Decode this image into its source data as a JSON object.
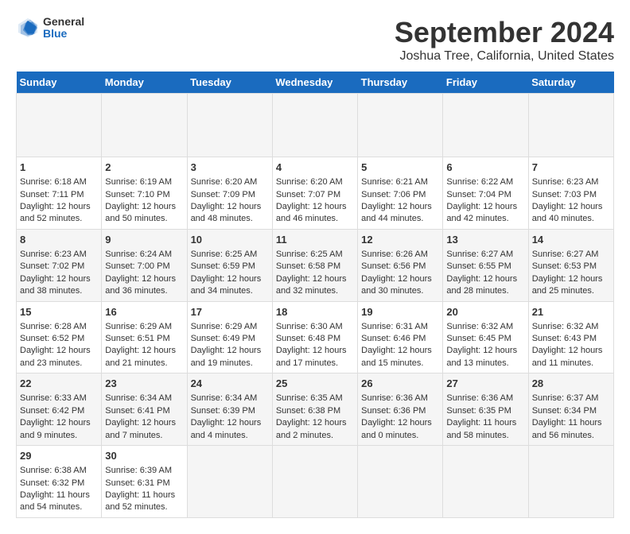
{
  "header": {
    "logo_general": "General",
    "logo_blue": "Blue",
    "title": "September 2024",
    "subtitle": "Joshua Tree, California, United States"
  },
  "calendar": {
    "days_of_week": [
      "Sunday",
      "Monday",
      "Tuesday",
      "Wednesday",
      "Thursday",
      "Friday",
      "Saturday"
    ],
    "weeks": [
      [
        {
          "day": "",
          "empty": true
        },
        {
          "day": "",
          "empty": true
        },
        {
          "day": "",
          "empty": true
        },
        {
          "day": "",
          "empty": true
        },
        {
          "day": "",
          "empty": true
        },
        {
          "day": "",
          "empty": true
        },
        {
          "day": "",
          "empty": true
        }
      ],
      [
        {
          "day": "1",
          "sunrise": "6:18 AM",
          "sunset": "7:11 PM",
          "daylight": "12 hours and 52 minutes."
        },
        {
          "day": "2",
          "sunrise": "6:19 AM",
          "sunset": "7:10 PM",
          "daylight": "12 hours and 50 minutes."
        },
        {
          "day": "3",
          "sunrise": "6:20 AM",
          "sunset": "7:09 PM",
          "daylight": "12 hours and 48 minutes."
        },
        {
          "day": "4",
          "sunrise": "6:20 AM",
          "sunset": "7:07 PM",
          "daylight": "12 hours and 46 minutes."
        },
        {
          "day": "5",
          "sunrise": "6:21 AM",
          "sunset": "7:06 PM",
          "daylight": "12 hours and 44 minutes."
        },
        {
          "day": "6",
          "sunrise": "6:22 AM",
          "sunset": "7:04 PM",
          "daylight": "12 hours and 42 minutes."
        },
        {
          "day": "7",
          "sunrise": "6:23 AM",
          "sunset": "7:03 PM",
          "daylight": "12 hours and 40 minutes."
        }
      ],
      [
        {
          "day": "8",
          "sunrise": "6:23 AM",
          "sunset": "7:02 PM",
          "daylight": "12 hours and 38 minutes."
        },
        {
          "day": "9",
          "sunrise": "6:24 AM",
          "sunset": "7:00 PM",
          "daylight": "12 hours and 36 minutes."
        },
        {
          "day": "10",
          "sunrise": "6:25 AM",
          "sunset": "6:59 PM",
          "daylight": "12 hours and 34 minutes."
        },
        {
          "day": "11",
          "sunrise": "6:25 AM",
          "sunset": "6:58 PM",
          "daylight": "12 hours and 32 minutes."
        },
        {
          "day": "12",
          "sunrise": "6:26 AM",
          "sunset": "6:56 PM",
          "daylight": "12 hours and 30 minutes."
        },
        {
          "day": "13",
          "sunrise": "6:27 AM",
          "sunset": "6:55 PM",
          "daylight": "12 hours and 28 minutes."
        },
        {
          "day": "14",
          "sunrise": "6:27 AM",
          "sunset": "6:53 PM",
          "daylight": "12 hours and 25 minutes."
        }
      ],
      [
        {
          "day": "15",
          "sunrise": "6:28 AM",
          "sunset": "6:52 PM",
          "daylight": "12 hours and 23 minutes."
        },
        {
          "day": "16",
          "sunrise": "6:29 AM",
          "sunset": "6:51 PM",
          "daylight": "12 hours and 21 minutes."
        },
        {
          "day": "17",
          "sunrise": "6:29 AM",
          "sunset": "6:49 PM",
          "daylight": "12 hours and 19 minutes."
        },
        {
          "day": "18",
          "sunrise": "6:30 AM",
          "sunset": "6:48 PM",
          "daylight": "12 hours and 17 minutes."
        },
        {
          "day": "19",
          "sunrise": "6:31 AM",
          "sunset": "6:46 PM",
          "daylight": "12 hours and 15 minutes."
        },
        {
          "day": "20",
          "sunrise": "6:32 AM",
          "sunset": "6:45 PM",
          "daylight": "12 hours and 13 minutes."
        },
        {
          "day": "21",
          "sunrise": "6:32 AM",
          "sunset": "6:43 PM",
          "daylight": "12 hours and 11 minutes."
        }
      ],
      [
        {
          "day": "22",
          "sunrise": "6:33 AM",
          "sunset": "6:42 PM",
          "daylight": "12 hours and 9 minutes."
        },
        {
          "day": "23",
          "sunrise": "6:34 AM",
          "sunset": "6:41 PM",
          "daylight": "12 hours and 7 minutes."
        },
        {
          "day": "24",
          "sunrise": "6:34 AM",
          "sunset": "6:39 PM",
          "daylight": "12 hours and 4 minutes."
        },
        {
          "day": "25",
          "sunrise": "6:35 AM",
          "sunset": "6:38 PM",
          "daylight": "12 hours and 2 minutes."
        },
        {
          "day": "26",
          "sunrise": "6:36 AM",
          "sunset": "6:36 PM",
          "daylight": "12 hours and 0 minutes."
        },
        {
          "day": "27",
          "sunrise": "6:36 AM",
          "sunset": "6:35 PM",
          "daylight": "11 hours and 58 minutes."
        },
        {
          "day": "28",
          "sunrise": "6:37 AM",
          "sunset": "6:34 PM",
          "daylight": "11 hours and 56 minutes."
        }
      ],
      [
        {
          "day": "29",
          "sunrise": "6:38 AM",
          "sunset": "6:32 PM",
          "daylight": "11 hours and 54 minutes."
        },
        {
          "day": "30",
          "sunrise": "6:39 AM",
          "sunset": "6:31 PM",
          "daylight": "11 hours and 52 minutes."
        },
        {
          "day": "",
          "empty": true
        },
        {
          "day": "",
          "empty": true
        },
        {
          "day": "",
          "empty": true
        },
        {
          "day": "",
          "empty": true
        },
        {
          "day": "",
          "empty": true
        }
      ]
    ]
  }
}
